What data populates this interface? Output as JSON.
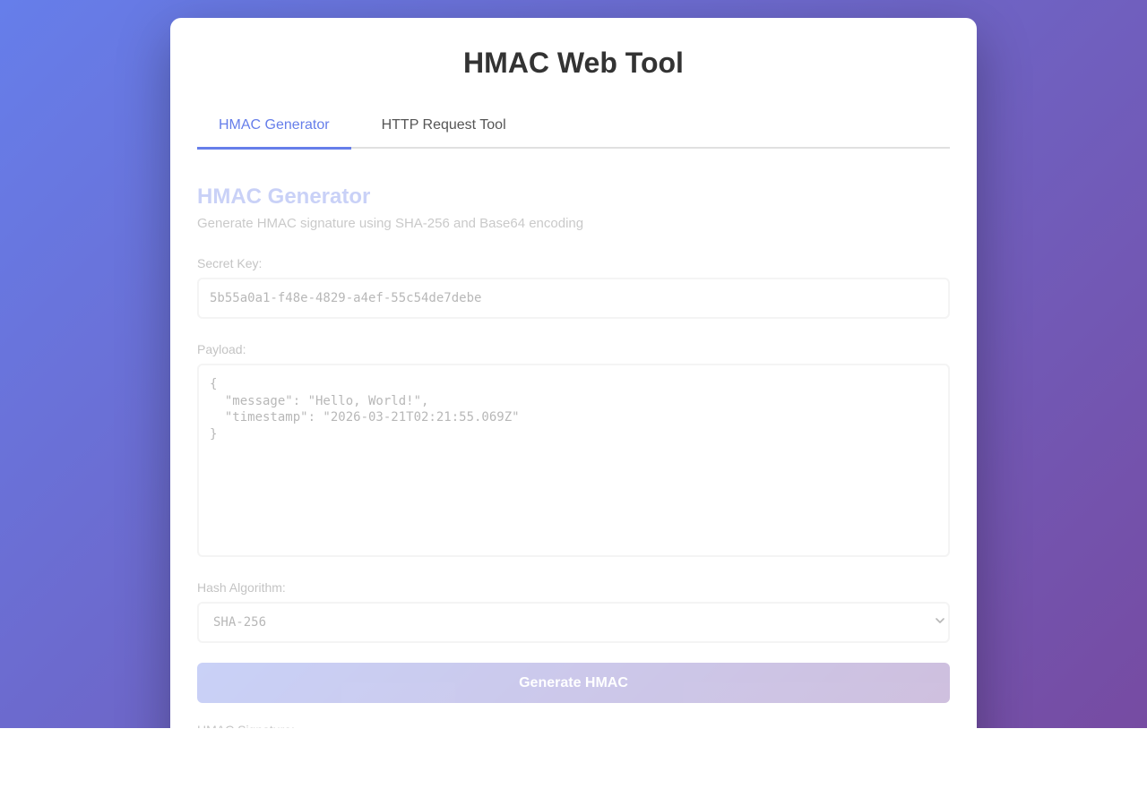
{
  "app": {
    "title": "HMAC Web Tool"
  },
  "tabs": [
    {
      "label": "HMAC Generator",
      "active": true
    },
    {
      "label": "HTTP Request Tool",
      "active": false
    }
  ],
  "generator": {
    "heading": "HMAC Generator",
    "description": "Generate HMAC signature using SHA-256 and Base64 encoding",
    "secret_key": {
      "label": "Secret Key:",
      "value": "5b55a0a1-f48e-4829-a4ef-55c54de7debe"
    },
    "payload": {
      "label": "Payload:",
      "value": "{\n  \"message\": \"Hello, World!\",\n  \"timestamp\": \"2026-03-21T02:21:55.069Z\"\n}"
    },
    "hash_algorithm": {
      "label": "Hash Algorithm:",
      "selected": "SHA-256"
    },
    "generate_label": "Generate HMAC",
    "signature_label": "HMAC Signature:"
  },
  "colors": {
    "accent": "#667eea",
    "gradient_start": "#667eea",
    "gradient_end": "#764ba2"
  },
  "icons": {
    "select_arrow": "chevron-down-icon"
  }
}
